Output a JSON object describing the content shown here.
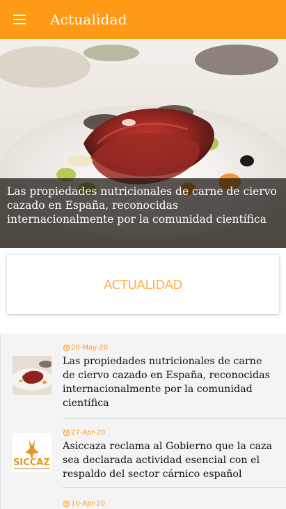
{
  "app_bar": {
    "title": "Actualidad",
    "menu_icon": "hamburger-menu-icon",
    "color": "#ff9a16"
  },
  "featured": {
    "caption": "Las propiedades nutricionales de carne de ciervo cazado en España, reconocidas internacionalmente por la comunidad científica"
  },
  "section": {
    "label": "ACTUALIDAD",
    "label_color": "#ffb04a"
  },
  "news": [
    {
      "date": "20-May-20",
      "title": "Las propiedades nutricionales de carne de ciervo cazado en España, reconocidas internacionalmente por la comunidad científica",
      "thumbnail": "venison-dish-thumbnail"
    },
    {
      "date": "27-Apr-20",
      "title": "Asiccaza reclama al Gobierno que la caza sea declarada actividad esencial con el respaldo del sector cárnico español",
      "thumbnail": "asiccaza-logo-thumbnail",
      "thumbnail_text": "SICCAZ"
    },
    {
      "date": "10-Apr-20"
    }
  ],
  "colors": {
    "accent": "#ff9a16",
    "list_background": "#f4f4f4"
  }
}
